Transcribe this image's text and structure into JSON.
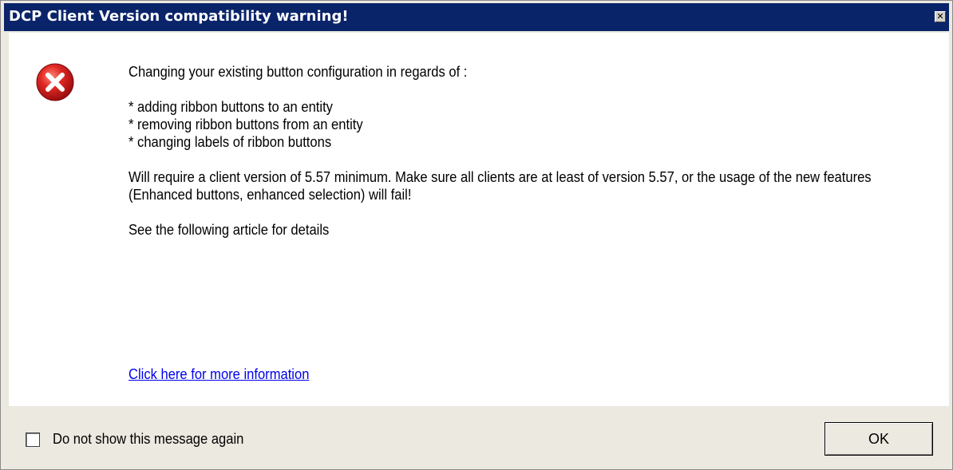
{
  "window": {
    "title": "DCP Client Version compatibility warning!",
    "close_glyph": "✕"
  },
  "icon": {
    "name": "error-icon",
    "color": "#c8151b"
  },
  "message": {
    "intro": "Changing your existing button configuration in regards of :",
    "items": [
      "* adding ribbon buttons to an entity",
      "* removing ribbon buttons from an entity",
      "* changing labels of ribbon buttons"
    ],
    "requirement": " Will require a client version of 5.57 minimum. Make sure all clients are at least of version 5.57,  or the usage of the new features (Enhanced buttons, enhanced selection) will fail!",
    "article_note": " See the following article for details"
  },
  "link": {
    "text": "Click here for more information"
  },
  "footer": {
    "checkbox_label": "Do not show this message again",
    "checkbox_checked": false,
    "ok_label": "OK"
  }
}
